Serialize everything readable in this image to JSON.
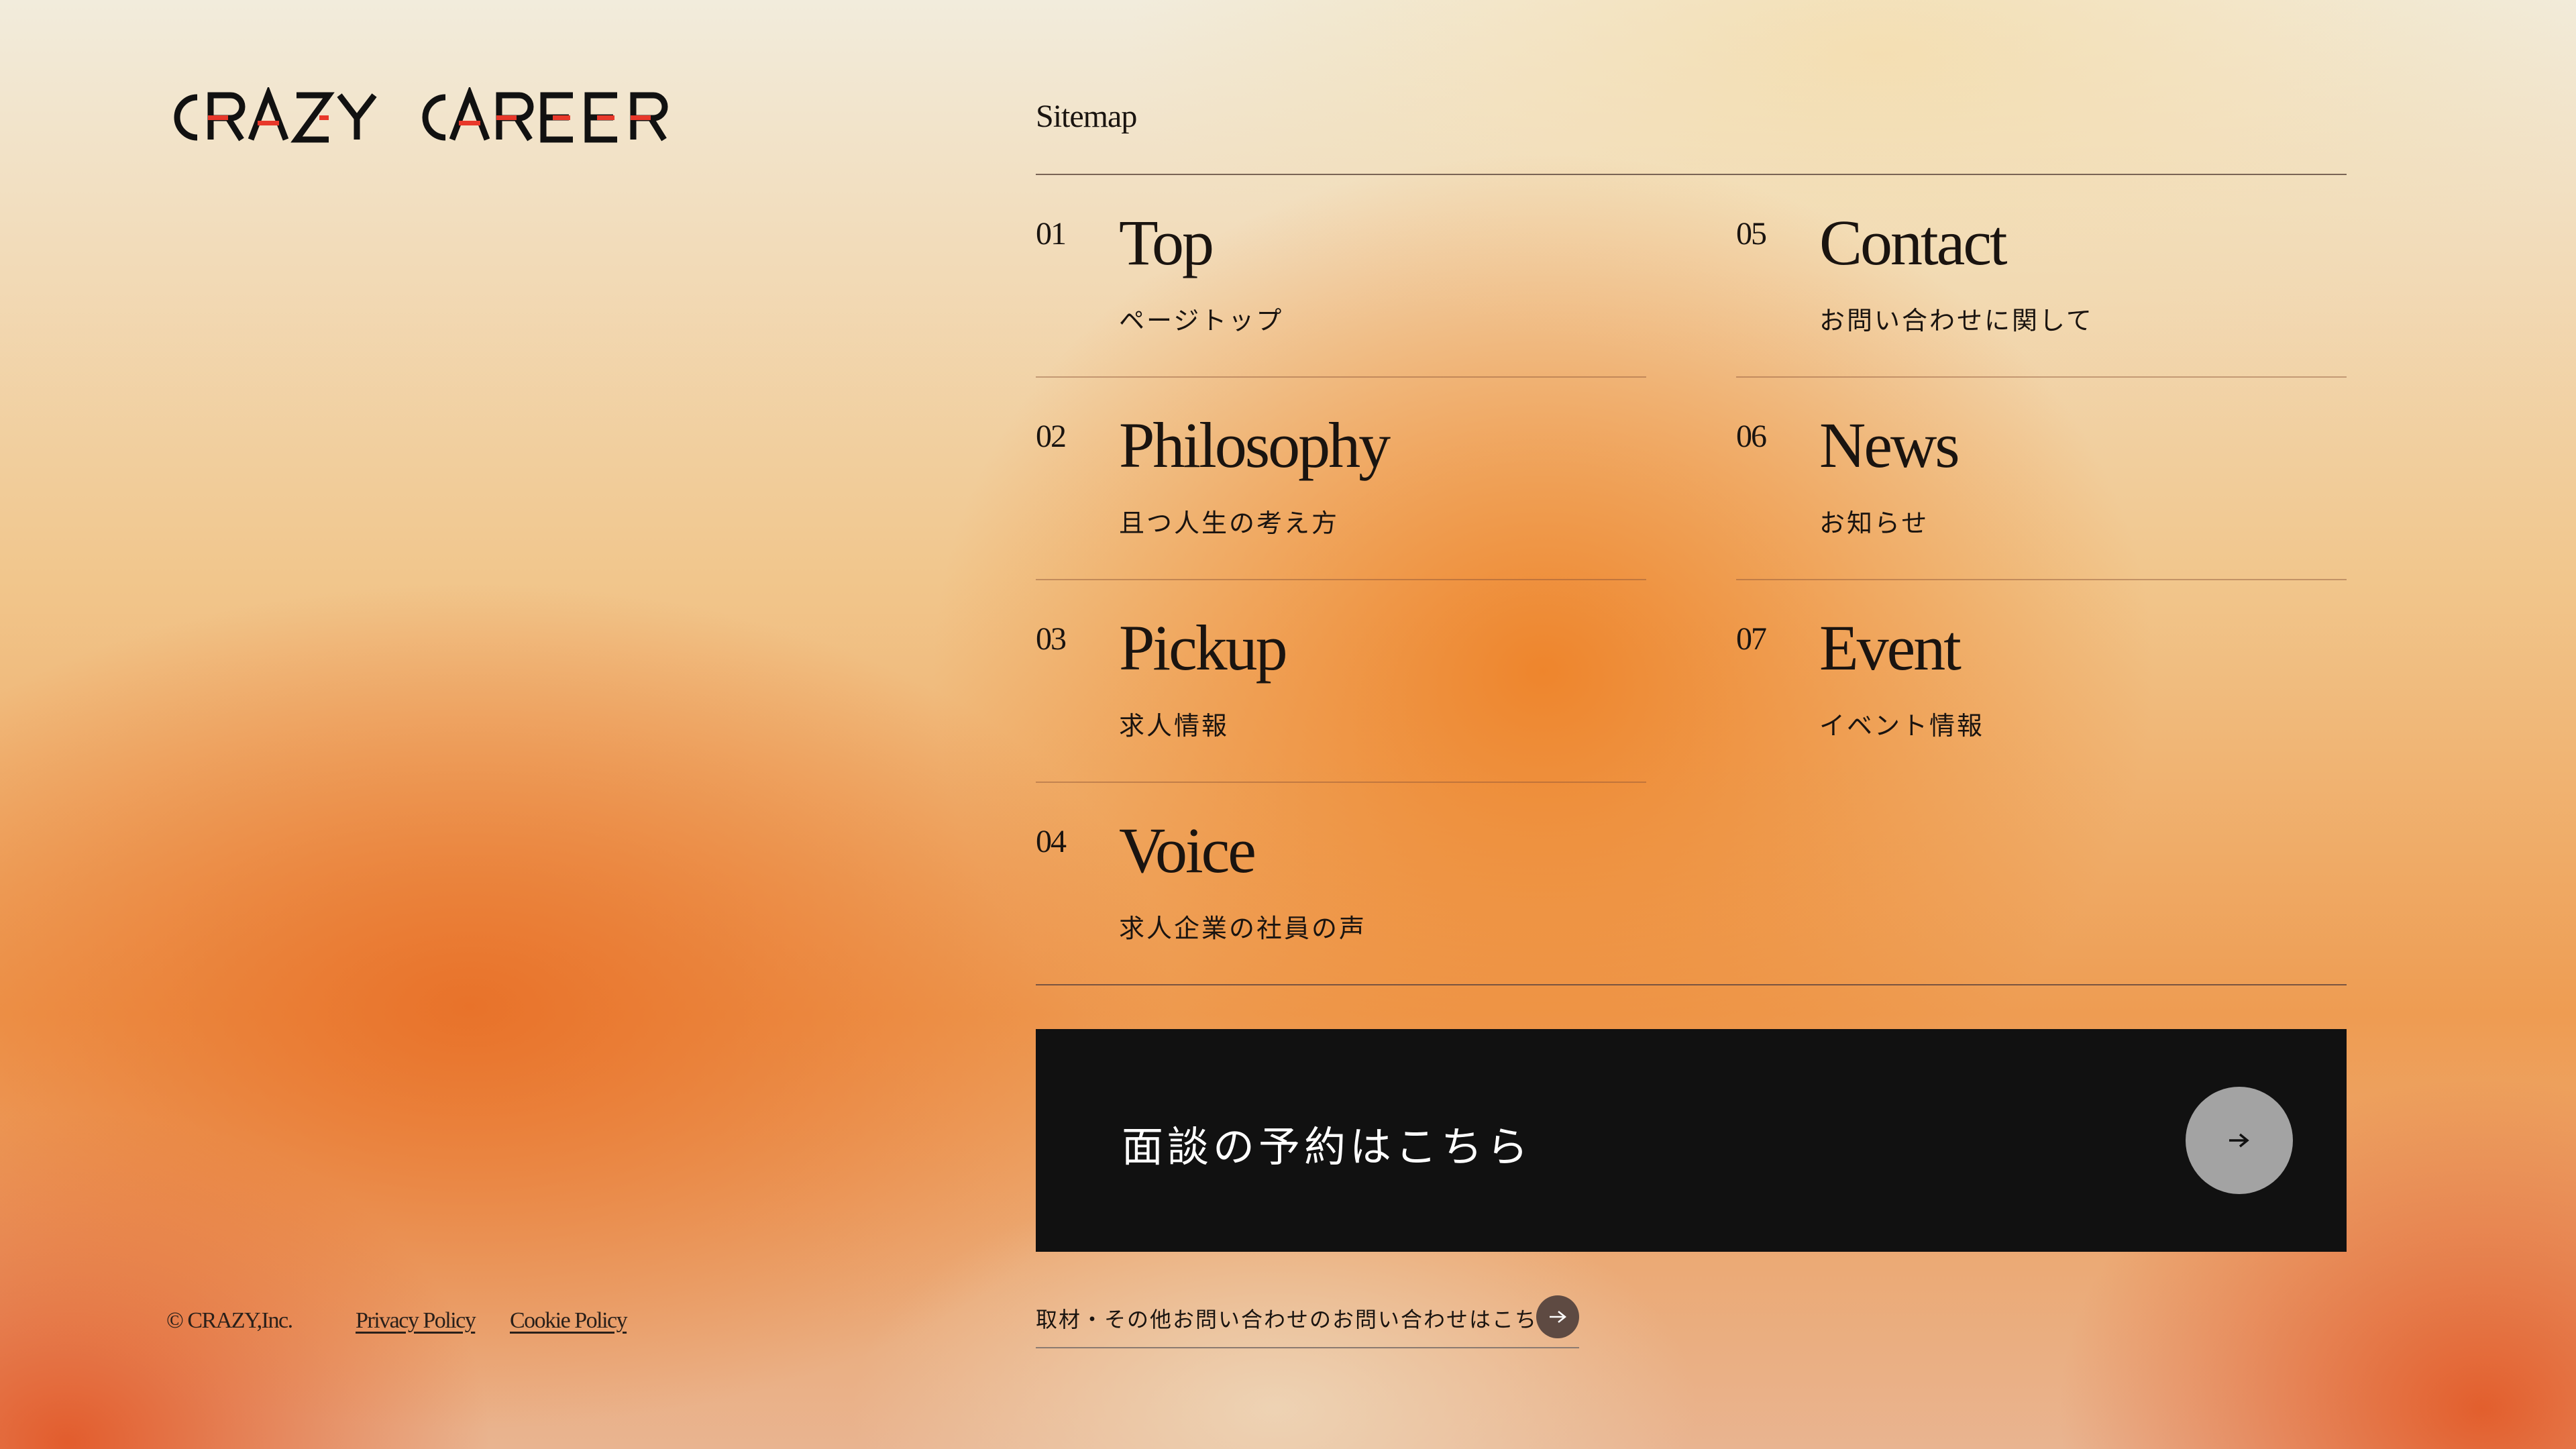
{
  "brand": {
    "logo_text": "CRAZY CAREER",
    "logo_colors": {
      "dark": "#111111",
      "accent": "#e8382a"
    }
  },
  "sitemap": {
    "label": "Sitemap",
    "items": [
      {
        "num": "01",
        "title": "Top",
        "sub": "ページトップ"
      },
      {
        "num": "02",
        "title": "Philosophy",
        "sub": "且つ人生の考え方"
      },
      {
        "num": "03",
        "title": "Pickup",
        "sub": "求人情報"
      },
      {
        "num": "04",
        "title": "Voice",
        "sub": "求人企業の社員の声"
      },
      {
        "num": "05",
        "title": "Contact",
        "sub": "お問い合わせに関して"
      },
      {
        "num": "06",
        "title": "News",
        "sub": "お知らせ"
      },
      {
        "num": "07",
        "title": "Event",
        "sub": "イベント情報"
      }
    ]
  },
  "cta": {
    "label": "面談の予約はこちら",
    "icon": "arrow-right-icon",
    "background": "#111111"
  },
  "inquiry": {
    "label": "取材・その他お問い合わせのお問い合わせはこちら",
    "icon": "arrow-right-icon"
  },
  "footer": {
    "copyright": "© CRAZY,Inc.",
    "privacy": "Privacy Policy",
    "cookie": "Cookie Policy"
  }
}
